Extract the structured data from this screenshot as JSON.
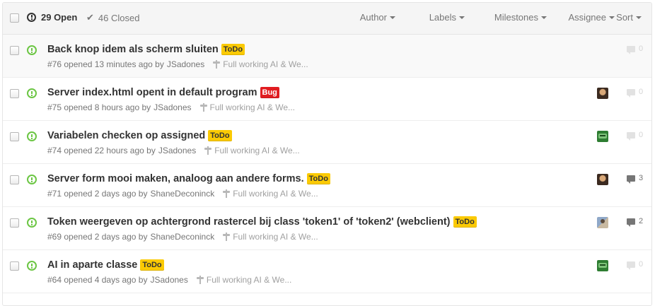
{
  "header": {
    "open_label": "29 Open",
    "closed_label": "46 Closed",
    "filters": [
      "Author",
      "Labels",
      "Milestones",
      "Assignee",
      "Sort"
    ]
  },
  "issues": [
    {
      "title": "Back knop idem als scherm sluiten",
      "label": "ToDo",
      "label_type": "todo",
      "number": "#76",
      "opened": "opened 13 minutes ago by",
      "author": "JSadones",
      "milestone": "Full working AI & We...",
      "avatar": "none",
      "comments": "0"
    },
    {
      "title": "Server index.html opent in default program",
      "label": "Bug",
      "label_type": "bug",
      "number": "#75",
      "opened": "opened 8 hours ago by",
      "author": "JSadones",
      "milestone": "Full working AI & We...",
      "avatar": "a",
      "comments": "0"
    },
    {
      "title": "Variabelen checken op assigned",
      "label": "ToDo",
      "label_type": "todo",
      "number": "#74",
      "opened": "opened 22 hours ago by",
      "author": "JSadones",
      "milestone": "Full working AI & We...",
      "avatar": "b",
      "comments": "0"
    },
    {
      "title": "Server form mooi maken, analoog aan andere forms.",
      "label": "ToDo",
      "label_type": "todo",
      "number": "#71",
      "opened": "opened 2 days ago by",
      "author": "ShaneDeconinck",
      "milestone": "Full working AI & We...",
      "avatar": "a",
      "comments": "3"
    },
    {
      "title": "Token weergeven op achtergrond rastercel bij class 'token1' of 'token2' (webclient)",
      "label": "ToDo",
      "label_type": "todo",
      "number": "#69",
      "opened": "opened 2 days ago by",
      "author": "ShaneDeconinck",
      "milestone": "Full working AI & We...",
      "avatar": "c",
      "comments": "2"
    },
    {
      "title": "AI in aparte classe",
      "label": "ToDo",
      "label_type": "todo",
      "number": "#64",
      "opened": "opened 4 days ago by",
      "author": "JSadones",
      "milestone": "Full working AI & We...",
      "avatar": "b",
      "comments": "0"
    }
  ],
  "colors": {
    "open_green": "#6cc644",
    "todo_yellow": "#fbca04",
    "bug_red": "#e11d21"
  }
}
